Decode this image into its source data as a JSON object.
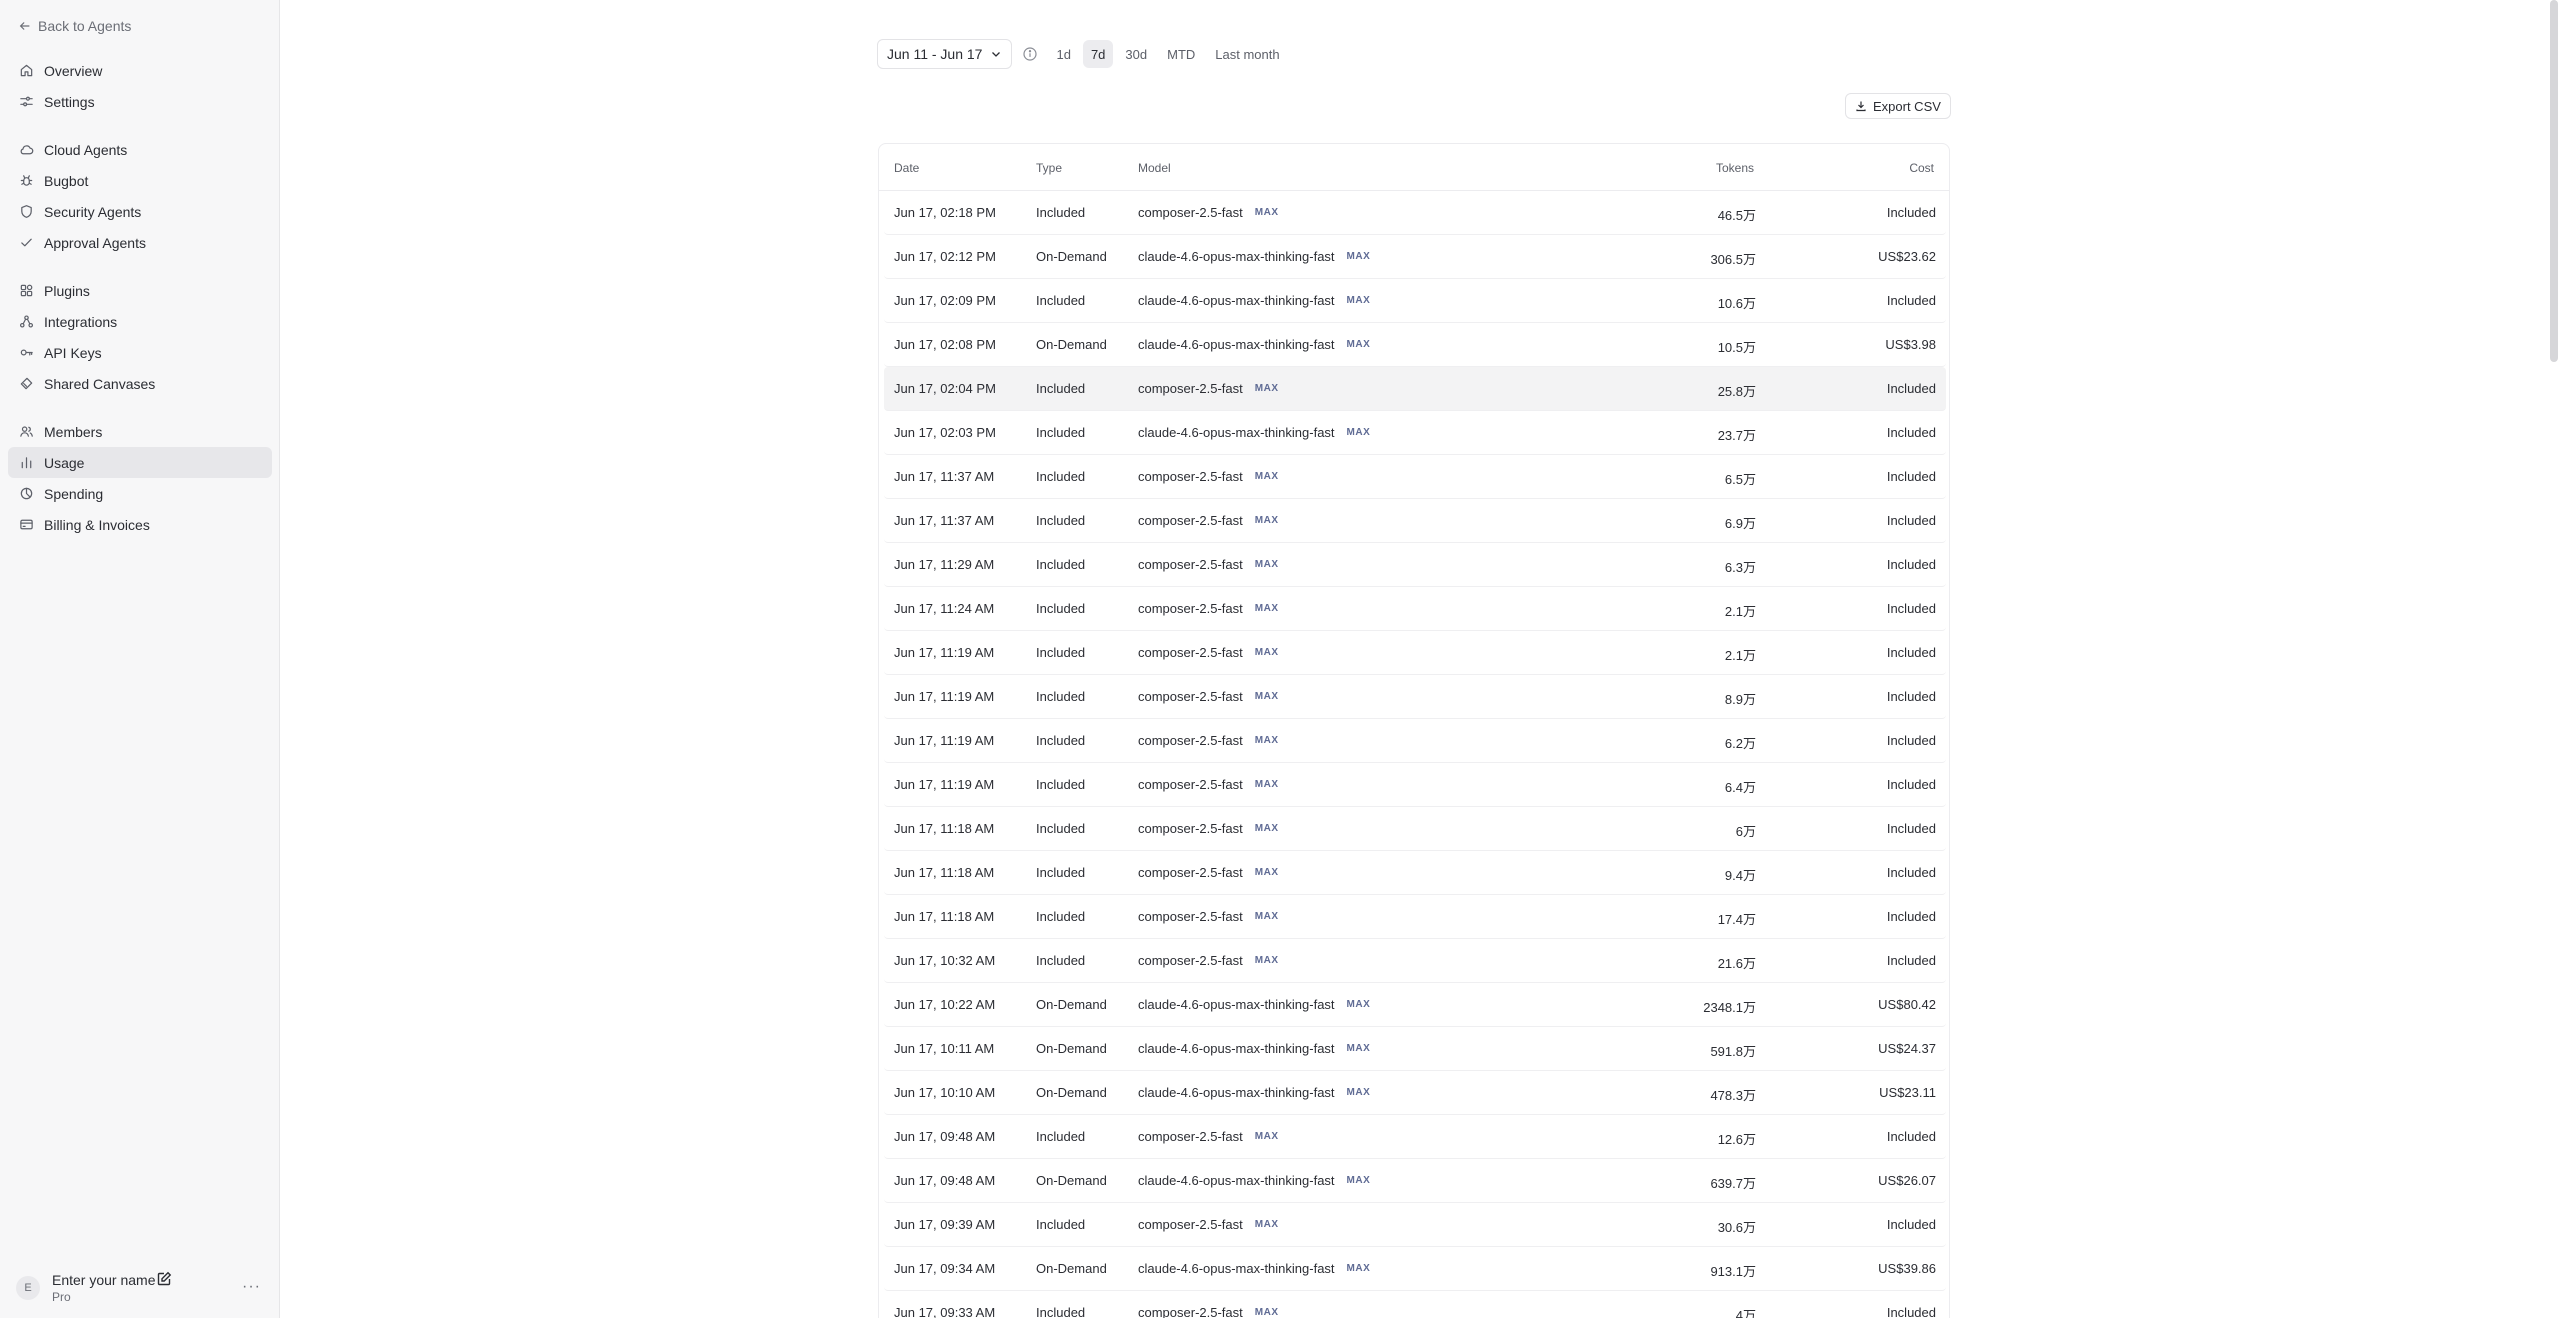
{
  "sidebar": {
    "back_label": "Back to Agents",
    "groups": [
      [
        {
          "label": "Overview",
          "icon": "home-icon"
        },
        {
          "label": "Settings",
          "icon": "sliders-icon"
        }
      ],
      [
        {
          "label": "Cloud Agents",
          "icon": "cloud-icon"
        },
        {
          "label": "Bugbot",
          "icon": "bug-icon"
        },
        {
          "label": "Security Agents",
          "icon": "shield-icon"
        },
        {
          "label": "Approval Agents",
          "icon": "check-icon"
        }
      ],
      [
        {
          "label": "Plugins",
          "icon": "plugin-icon"
        },
        {
          "label": "Integrations",
          "icon": "integrations-icon"
        },
        {
          "label": "API Keys",
          "icon": "key-icon"
        },
        {
          "label": "Shared Canvases",
          "icon": "canvas-icon"
        }
      ],
      [
        {
          "label": "Members",
          "icon": "users-icon"
        },
        {
          "label": "Usage",
          "icon": "bar-chart-icon",
          "active": true
        },
        {
          "label": "Spending",
          "icon": "spending-icon"
        },
        {
          "label": "Billing & Invoices",
          "icon": "card-icon"
        }
      ]
    ],
    "profile": {
      "initial": "E",
      "name": "Enter your name",
      "plan": "Pro"
    }
  },
  "filters": {
    "date_range": "Jun 11 - Jun 17",
    "presets": [
      "1d",
      "7d",
      "30d",
      "MTD",
      "Last month"
    ],
    "active_preset": "7d"
  },
  "export_label": "Export CSV",
  "table": {
    "headers": {
      "date": "Date",
      "type": "Type",
      "model": "Model",
      "tokens": "Tokens",
      "cost": "Cost"
    },
    "badge": "MAX",
    "rows": [
      {
        "date": "Jun 17, 02:18 PM",
        "type": "Included",
        "model": "composer-2.5-fast",
        "tokens": "46.5万",
        "cost": "Included"
      },
      {
        "date": "Jun 17, 02:12 PM",
        "type": "On-Demand",
        "model": "claude-4.6-opus-max-thinking-fast",
        "tokens": "306.5万",
        "cost": "US$23.62"
      },
      {
        "date": "Jun 17, 02:09 PM",
        "type": "Included",
        "model": "claude-4.6-opus-max-thinking-fast",
        "tokens": "10.6万",
        "cost": "Included"
      },
      {
        "date": "Jun 17, 02:08 PM",
        "type": "On-Demand",
        "model": "claude-4.6-opus-max-thinking-fast",
        "tokens": "10.5万",
        "cost": "US$3.98"
      },
      {
        "date": "Jun 17, 02:04 PM",
        "type": "Included",
        "model": "composer-2.5-fast",
        "tokens": "25.8万",
        "cost": "Included",
        "hover": true
      },
      {
        "date": "Jun 17, 02:03 PM",
        "type": "Included",
        "model": "claude-4.6-opus-max-thinking-fast",
        "tokens": "23.7万",
        "cost": "Included"
      },
      {
        "date": "Jun 17, 11:37 AM",
        "type": "Included",
        "model": "composer-2.5-fast",
        "tokens": "6.5万",
        "cost": "Included"
      },
      {
        "date": "Jun 17, 11:37 AM",
        "type": "Included",
        "model": "composer-2.5-fast",
        "tokens": "6.9万",
        "cost": "Included"
      },
      {
        "date": "Jun 17, 11:29 AM",
        "type": "Included",
        "model": "composer-2.5-fast",
        "tokens": "6.3万",
        "cost": "Included"
      },
      {
        "date": "Jun 17, 11:24 AM",
        "type": "Included",
        "model": "composer-2.5-fast",
        "tokens": "2.1万",
        "cost": "Included"
      },
      {
        "date": "Jun 17, 11:19 AM",
        "type": "Included",
        "model": "composer-2.5-fast",
        "tokens": "2.1万",
        "cost": "Included"
      },
      {
        "date": "Jun 17, 11:19 AM",
        "type": "Included",
        "model": "composer-2.5-fast",
        "tokens": "8.9万",
        "cost": "Included"
      },
      {
        "date": "Jun 17, 11:19 AM",
        "type": "Included",
        "model": "composer-2.5-fast",
        "tokens": "6.2万",
        "cost": "Included"
      },
      {
        "date": "Jun 17, 11:19 AM",
        "type": "Included",
        "model": "composer-2.5-fast",
        "tokens": "6.4万",
        "cost": "Included"
      },
      {
        "date": "Jun 17, 11:18 AM",
        "type": "Included",
        "model": "composer-2.5-fast",
        "tokens": "6万",
        "cost": "Included"
      },
      {
        "date": "Jun 17, 11:18 AM",
        "type": "Included",
        "model": "composer-2.5-fast",
        "tokens": "9.4万",
        "cost": "Included"
      },
      {
        "date": "Jun 17, 11:18 AM",
        "type": "Included",
        "model": "composer-2.5-fast",
        "tokens": "17.4万",
        "cost": "Included"
      },
      {
        "date": "Jun 17, 10:32 AM",
        "type": "Included",
        "model": "composer-2.5-fast",
        "tokens": "21.6万",
        "cost": "Included"
      },
      {
        "date": "Jun 17, 10:22 AM",
        "type": "On-Demand",
        "model": "claude-4.6-opus-max-thinking-fast",
        "tokens": "2348.1万",
        "cost": "US$80.42"
      },
      {
        "date": "Jun 17, 10:11 AM",
        "type": "On-Demand",
        "model": "claude-4.6-opus-max-thinking-fast",
        "tokens": "591.8万",
        "cost": "US$24.37"
      },
      {
        "date": "Jun 17, 10:10 AM",
        "type": "On-Demand",
        "model": "claude-4.6-opus-max-thinking-fast",
        "tokens": "478.3万",
        "cost": "US$23.11"
      },
      {
        "date": "Jun 17, 09:48 AM",
        "type": "Included",
        "model": "composer-2.5-fast",
        "tokens": "12.6万",
        "cost": "Included"
      },
      {
        "date": "Jun 17, 09:48 AM",
        "type": "On-Demand",
        "model": "claude-4.6-opus-max-thinking-fast",
        "tokens": "639.7万",
        "cost": "US$26.07"
      },
      {
        "date": "Jun 17, 09:39 AM",
        "type": "Included",
        "model": "composer-2.5-fast",
        "tokens": "30.6万",
        "cost": "Included"
      },
      {
        "date": "Jun 17, 09:34 AM",
        "type": "On-Demand",
        "model": "claude-4.6-opus-max-thinking-fast",
        "tokens": "913.1万",
        "cost": "US$39.86"
      },
      {
        "date": "Jun 17, 09:33 AM",
        "type": "Included",
        "model": "composer-2.5-fast",
        "tokens": "4万",
        "cost": "Included"
      }
    ]
  }
}
